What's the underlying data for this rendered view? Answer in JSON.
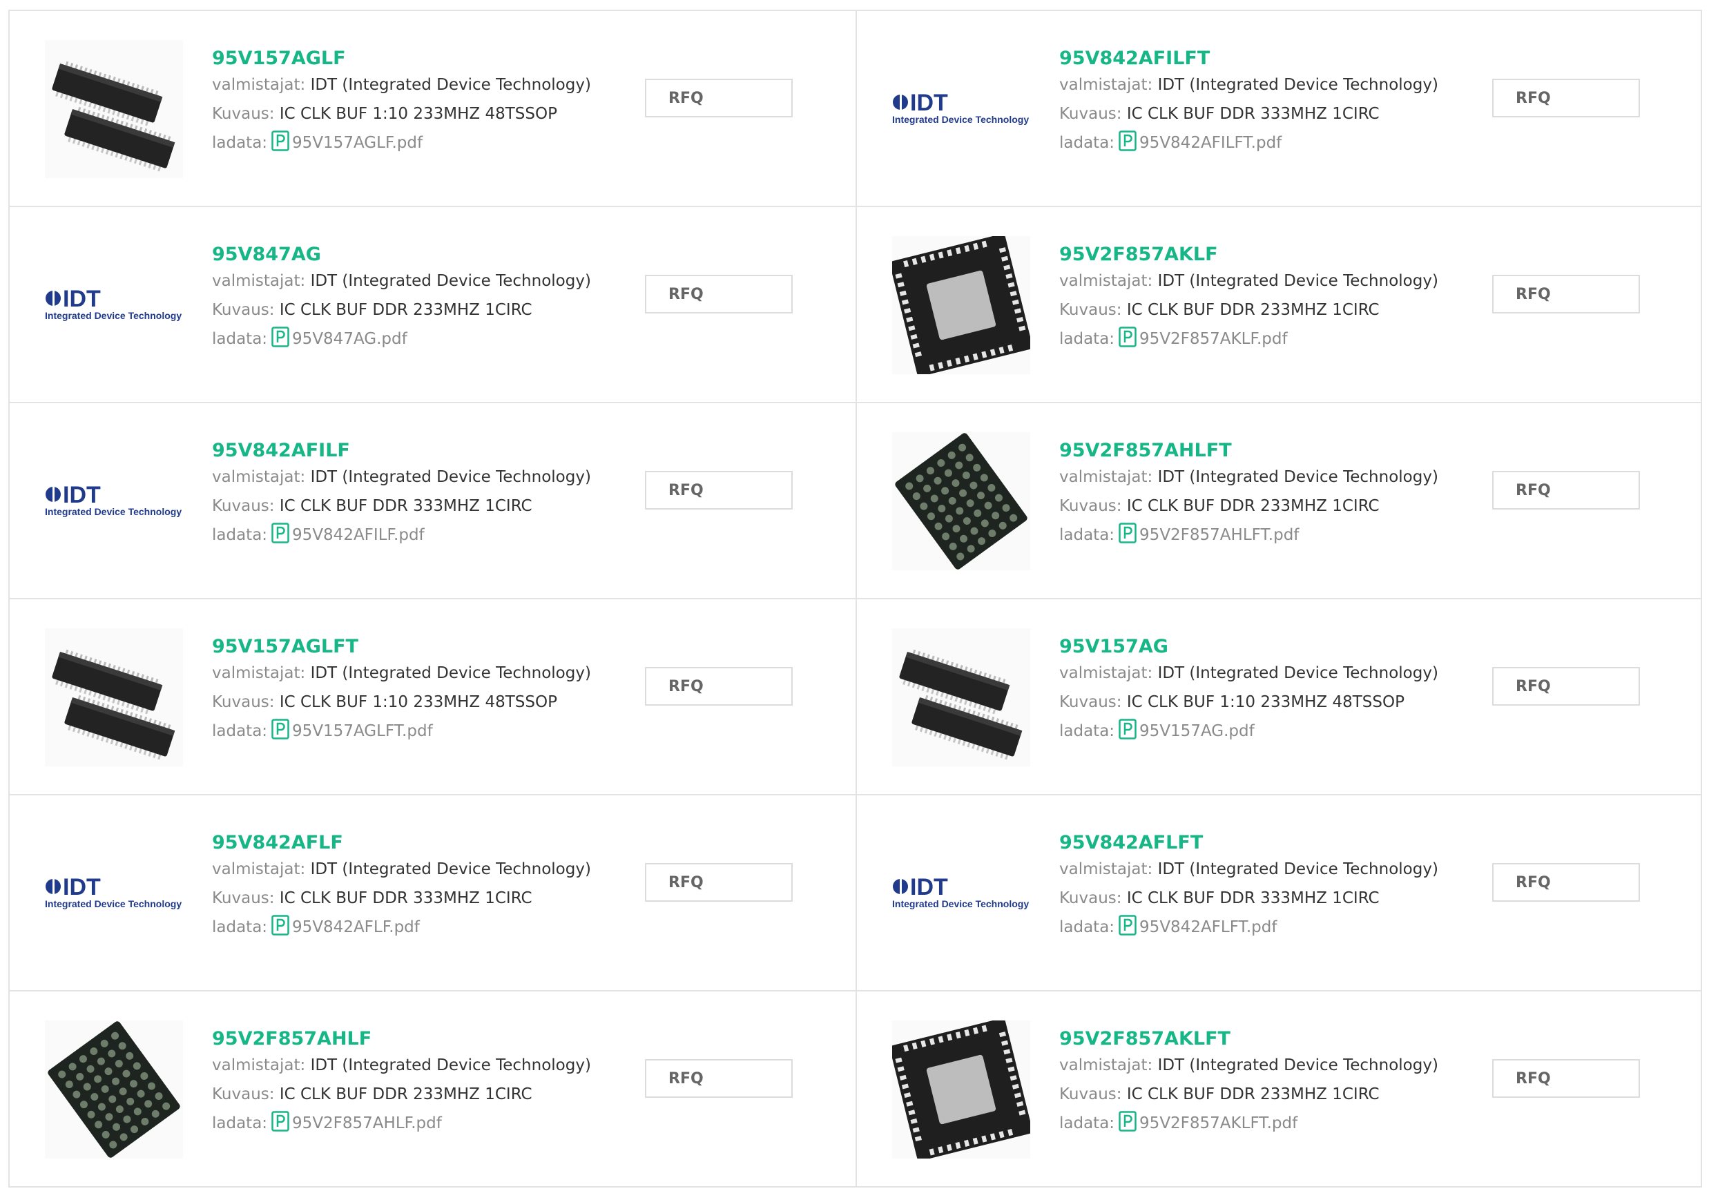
{
  "labels": {
    "manufacturer": "valmistajat:",
    "description": "Kuvaus:",
    "download": "ladata:",
    "rfq": "RFQ"
  },
  "brand_color": "#17b686",
  "logo": {
    "mark": "IDT",
    "tagline": "Integrated Device Technology"
  },
  "products": [
    {
      "name": "95V157AGLF",
      "manufacturer": "IDT (Integrated Device Technology)",
      "description": "IC CLK BUF 1:10 233MHZ 48TSSOP",
      "file": "95V157AGLF.pdf",
      "image": "tssop-chip-icon"
    },
    {
      "name": "95V842AFILFT",
      "manufacturer": "IDT (Integrated Device Technology)",
      "description": "IC CLK BUF DDR 333MHZ 1CIRC",
      "file": "95V842AFILFT.pdf",
      "image": "idt-logo"
    },
    {
      "name": "95V847AG",
      "manufacturer": "IDT (Integrated Device Technology)",
      "description": "IC CLK BUF DDR 233MHZ 1CIRC",
      "file": "95V847AG.pdf",
      "image": "idt-logo"
    },
    {
      "name": "95V2F857AKLF",
      "manufacturer": "IDT (Integrated Device Technology)",
      "description": "IC CLK BUF DDR 233MHZ 1CIRC",
      "file": "95V2F857AKLF.pdf",
      "image": "qfn-chip-icon"
    },
    {
      "name": "95V842AFILF",
      "manufacturer": "IDT (Integrated Device Technology)",
      "description": "IC CLK BUF DDR 333MHZ 1CIRC",
      "file": "95V842AFILF.pdf",
      "image": "idt-logo"
    },
    {
      "name": "95V2F857AHLFT",
      "manufacturer": "IDT (Integrated Device Technology)",
      "description": "IC CLK BUF DDR 233MHZ 1CIRC",
      "file": "95V2F857AHLFT.pdf",
      "image": "bga-chip-icon"
    },
    {
      "name": "95V157AGLFT",
      "manufacturer": "IDT (Integrated Device Technology)",
      "description": "IC CLK BUF 1:10 233MHZ 48TSSOP",
      "file": "95V157AGLFT.pdf",
      "image": "tssop-chip-icon"
    },
    {
      "name": "95V157AG",
      "manufacturer": "IDT (Integrated Device Technology)",
      "description": "IC CLK BUF 1:10 233MHZ 48TSSOP",
      "file": "95V157AG.pdf",
      "image": "tssop-chip-icon"
    },
    {
      "name": "95V842AFLF",
      "manufacturer": "IDT (Integrated Device Technology)",
      "description": "IC CLK BUF DDR 333MHZ 1CIRC",
      "file": "95V842AFLF.pdf",
      "image": "idt-logo"
    },
    {
      "name": "95V842AFLFT",
      "manufacturer": "IDT (Integrated Device Technology)",
      "description": "IC CLK BUF DDR 333MHZ 1CIRC",
      "file": "95V842AFLFT.pdf",
      "image": "idt-logo"
    },
    {
      "name": "95V2F857AHLF",
      "manufacturer": "IDT (Integrated Device Technology)",
      "description": "IC CLK BUF DDR 233MHZ 1CIRC",
      "file": "95V2F857AHLF.pdf",
      "image": "bga-chip-icon"
    },
    {
      "name": "95V2F857AKLFT",
      "manufacturer": "IDT (Integrated Device Technology)",
      "description": "IC CLK BUF DDR 233MHZ 1CIRC",
      "file": "95V2F857AKLFT.pdf",
      "image": "qfn-chip-icon"
    }
  ]
}
